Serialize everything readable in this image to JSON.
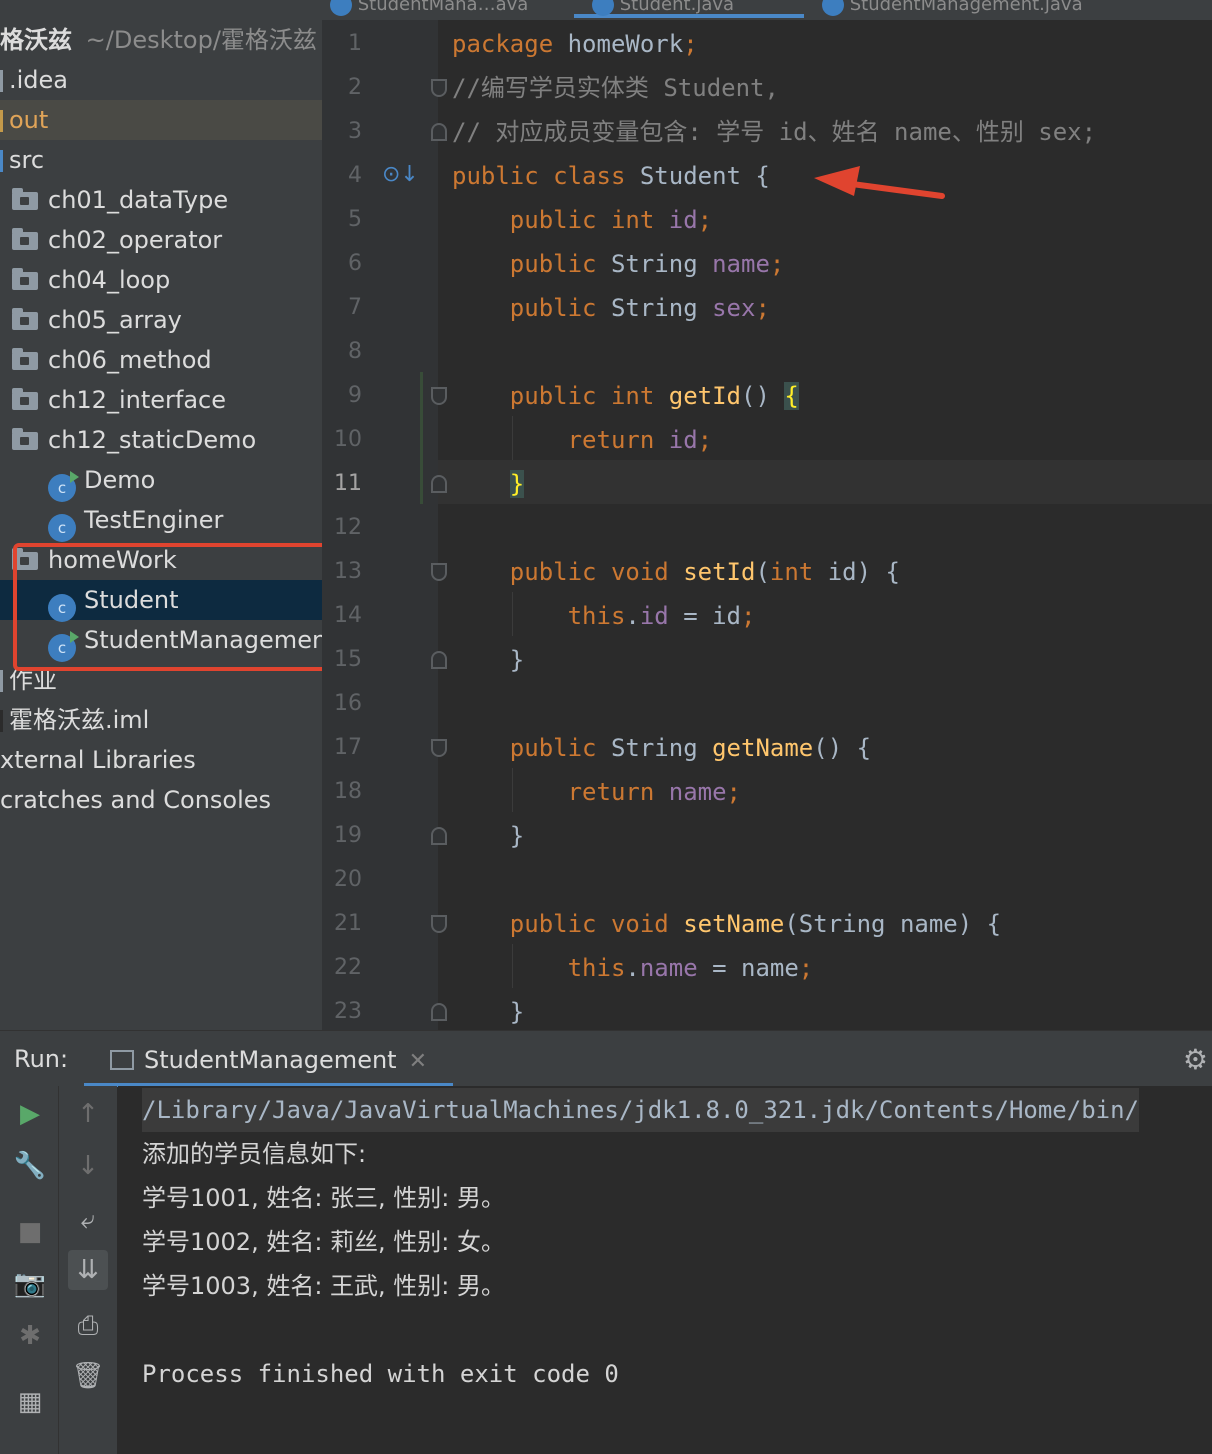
{
  "tabs": [
    {
      "label": "StudentMana…ava"
    },
    {
      "label": "Student.java"
    },
    {
      "label": "StudentManagement.java"
    }
  ],
  "project": {
    "root_name": "格沃兹",
    "root_path": "~/Desktop/霍格沃兹",
    "items": [
      {
        "label": ".idea"
      },
      {
        "label": "out"
      },
      {
        "label": "src"
      },
      {
        "label": "ch01_dataType"
      },
      {
        "label": "ch02_operator"
      },
      {
        "label": "ch04_loop"
      },
      {
        "label": "ch05_array"
      },
      {
        "label": "ch06_method"
      },
      {
        "label": "ch12_interface"
      },
      {
        "label": "ch12_staticDemo"
      },
      {
        "label": "Demo"
      },
      {
        "label": "TestEnginer"
      },
      {
        "label": "homeWork"
      },
      {
        "label": "Student"
      },
      {
        "label": "StudentManagemen"
      },
      {
        "label": "作业"
      },
      {
        "label": "霍格沃兹.iml"
      },
      {
        "label": "xternal Libraries"
      },
      {
        "label": "cratches and Consoles"
      }
    ],
    "class_icon_letter": "c"
  },
  "editor": {
    "line_numbers": [
      "1",
      "2",
      "3",
      "4",
      "5",
      "6",
      "7",
      "8",
      "9",
      "10",
      "11",
      "12",
      "13",
      "14",
      "15",
      "16",
      "17",
      "18",
      "19",
      "20",
      "21",
      "22",
      "23"
    ],
    "current_line": "11"
  },
  "run": {
    "label": "Run:",
    "tab": "StudentManagement",
    "output": [
      "/Library/Java/JavaVirtualMachines/jdk1.8.0_321.jdk/Contents/Home/bin/",
      "添加的学员信息如下:",
      "学号1001, 姓名: 张三, 性别: 男。",
      "学号1002, 姓名: 莉丝, 性别: 女。",
      "学号1003, 姓名: 王武, 性别: 男。",
      "",
      "Process finished with exit code 0"
    ]
  },
  "icons": {
    "run": "▶",
    "wrench": "🔧",
    "stop": "■",
    "camera": "📷",
    "bug": "✱",
    "layout": "▦",
    "up": "↑",
    "down": "↓",
    "wrap": "⤶",
    "scroll": "⇊",
    "print": "⎙",
    "trash": "🗑",
    "gear": "⚙"
  },
  "colors": {
    "accent": "#4a88c7",
    "highlight_box": "#e0442f",
    "keyword": "#cc7832",
    "field": "#9876aa",
    "method": "#ffc66d"
  }
}
